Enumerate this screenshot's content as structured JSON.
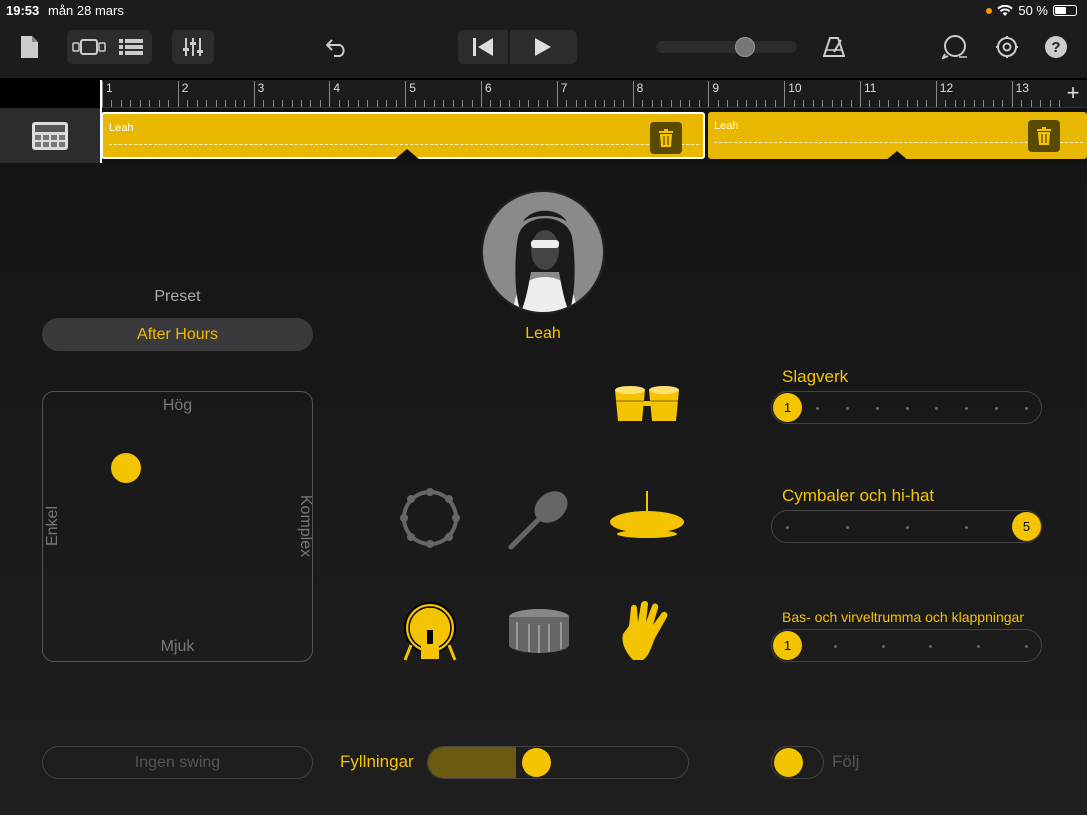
{
  "status": {
    "time": "19:53",
    "date": "mån 28 mars",
    "battery": "50 %"
  },
  "ruler": {
    "bars": [
      "1",
      "2",
      "3",
      "4",
      "5",
      "6",
      "7",
      "8",
      "9",
      "10",
      "11",
      "12",
      "13"
    ]
  },
  "track": {
    "regions": [
      {
        "name": "Leah"
      },
      {
        "name": "Leah"
      }
    ]
  },
  "drummer": {
    "name": "Leah"
  },
  "preset": {
    "label": "Preset",
    "value": "After Hours"
  },
  "xypad": {
    "top": "Hög",
    "bottom": "Mjuk",
    "left": "Enkel",
    "right": "Komplex"
  },
  "sliders": {
    "percussion": {
      "title": "Slagverk",
      "value": "1",
      "level": 1,
      "steps": 9
    },
    "cymbals": {
      "title": "Cymbaler och hi-hat",
      "value": "5",
      "level": 5,
      "steps": 5
    },
    "kick_snare": {
      "title": "Bas- och virveltrumma och klappningar",
      "value": "1",
      "level": 1,
      "steps": 6
    }
  },
  "bottom": {
    "swing": "Ingen swing",
    "fills_label": "Fyllningar",
    "fills_level": 0.25,
    "follow_label": "Följ"
  },
  "colors": {
    "accent": "#f5c400",
    "region": "#e8b800"
  }
}
